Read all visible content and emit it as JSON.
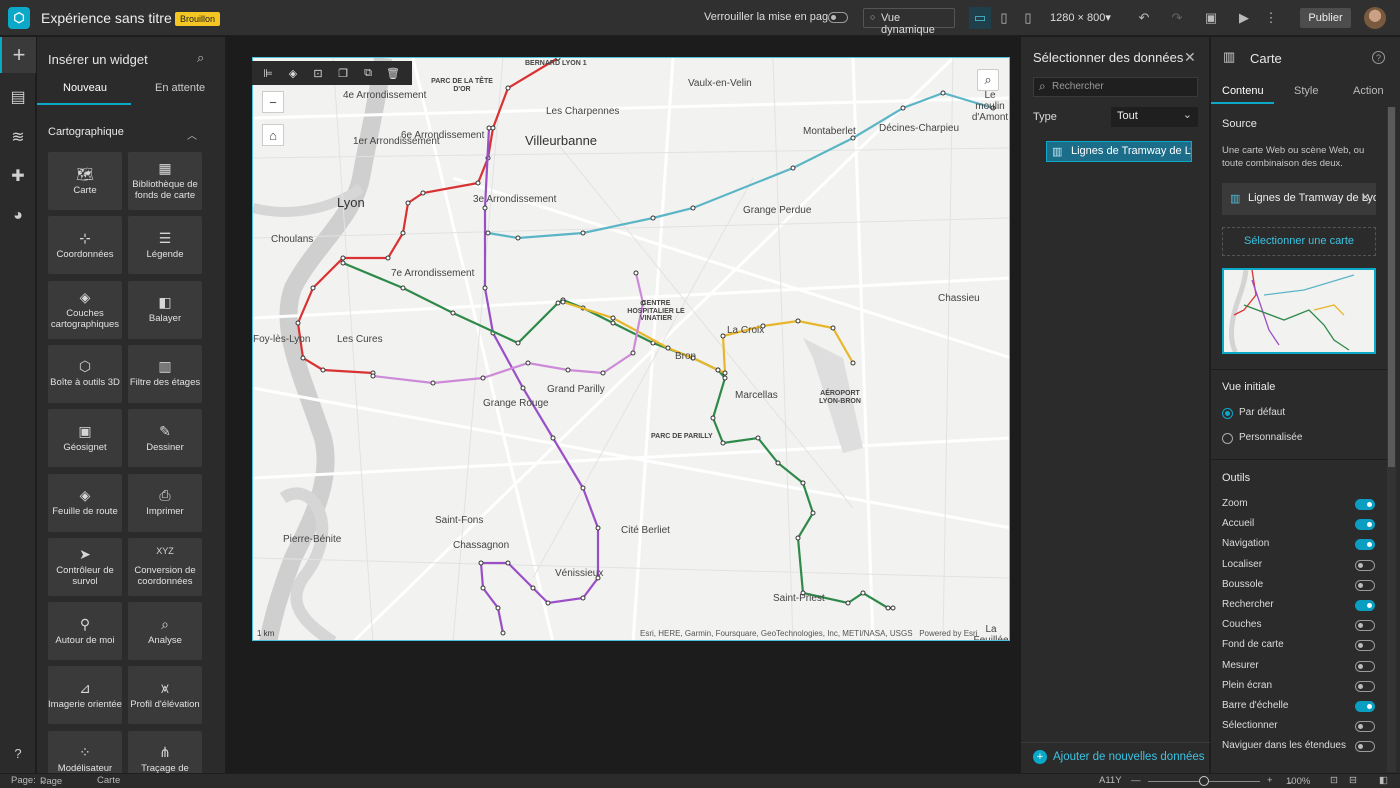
{
  "app": {
    "title": "Expérience sans titre 1",
    "badge": "Brouillon"
  },
  "topbar": {
    "lock_label": "Verrouiller la mise en page",
    "live_view_label": "Vue dynamique",
    "resolution": "1280 × 800",
    "publish_label": "Publier"
  },
  "widget_panel": {
    "title": "Insérer un widget",
    "tabs": [
      "Nouveau",
      "En attente"
    ],
    "category": "Cartographique",
    "widgets": [
      {
        "label": "Carte",
        "icon": "map-icon",
        "glyph": "🗺"
      },
      {
        "label": "Bibliothèque de fonds de carte",
        "icon": "basemap-gallery-icon",
        "glyph": "▦"
      },
      {
        "label": "Coordonnées",
        "icon": "coordinates-icon",
        "glyph": "⊹"
      },
      {
        "label": "Légende",
        "icon": "legend-icon",
        "glyph": "☰"
      },
      {
        "label": "Couches cartographiques",
        "icon": "layers-icon",
        "glyph": "◈"
      },
      {
        "label": "Balayer",
        "icon": "swipe-icon",
        "glyph": "◧"
      },
      {
        "label": "Boîte à outils 3D",
        "icon": "toolbox-3d-icon",
        "glyph": "⬡"
      },
      {
        "label": "Filtre des étages",
        "icon": "floor-filter-icon",
        "glyph": "▥"
      },
      {
        "label": "Géosignet",
        "icon": "bookmark-icon",
        "glyph": "▣"
      },
      {
        "label": "Dessiner",
        "icon": "draw-icon",
        "glyph": "✎"
      },
      {
        "label": "Feuille de route",
        "icon": "directions-icon",
        "glyph": "◈"
      },
      {
        "label": "Imprimer",
        "icon": "print-icon",
        "glyph": "⎙"
      },
      {
        "label": "Contrôleur de survol",
        "icon": "fly-controller-icon",
        "glyph": "➤"
      },
      {
        "label": "Conversion de coordonnées",
        "icon": "coordinate-conversion-icon",
        "glyph": "XYZ"
      },
      {
        "label": "Autour de moi",
        "icon": "near-me-icon",
        "glyph": "⚲"
      },
      {
        "label": "Analyse",
        "icon": "analysis-icon",
        "glyph": "⌕"
      },
      {
        "label": "Imagerie orientée",
        "icon": "oriented-imagery-icon",
        "glyph": "⊿"
      },
      {
        "label": "Profil d'élévation",
        "icon": "elevation-profile-icon",
        "glyph": "⩙"
      },
      {
        "label": "Modélisateur",
        "icon": "modeler-icon",
        "glyph": "⁘"
      },
      {
        "label": "Traçage de",
        "icon": "tracing-icon",
        "glyph": "⋔"
      }
    ]
  },
  "map": {
    "labels": [
      {
        "t": "BERNARD LYON 1",
        "small": true
      },
      {
        "t": "Vaulx-en-Velin"
      },
      {
        "t": "PARC DE LA TÊTE D'OR",
        "small": true
      },
      {
        "t": "Le moulin d'Amont",
        "small": false
      },
      {
        "t": "4e Arrondissement"
      },
      {
        "t": "Les Charpennes"
      },
      {
        "t": "Villeurbanne",
        "big": true
      },
      {
        "t": "Montaberlet"
      },
      {
        "t": "Décines-Charpieu"
      },
      {
        "t": "1er Arrondissement"
      },
      {
        "t": "6e Arrondissement"
      },
      {
        "t": "Lyon",
        "big": true
      },
      {
        "t": "3e Arrondissement"
      },
      {
        "t": "Grange Perdue"
      },
      {
        "t": "Choulans"
      },
      {
        "t": "7e Arrondissement"
      },
      {
        "t": "Chassieu"
      },
      {
        "t": "CENTRE HOSPITALIER LE VINATIER",
        "small": true
      },
      {
        "t": "La Croix"
      },
      {
        "t": "Les Cures"
      },
      {
        "t": "Bron"
      },
      {
        "t": "AÉROPORT LYON-BRON",
        "small": true
      },
      {
        "t": "Grand Parilly"
      },
      {
        "t": "Marcellas"
      },
      {
        "t": "Grange Rouge"
      },
      {
        "t": "PARC DE PARILLY",
        "small": true
      },
      {
        "t": "Saint-Fons"
      },
      {
        "t": "Cité Berliet"
      },
      {
        "t": "Pierre-Bénite"
      },
      {
        "t": "Chassagnon"
      },
      {
        "t": "Vénissieux"
      },
      {
        "t": "Saint-Priest"
      },
      {
        "t": "Foy-lès-Lyon"
      },
      {
        "t": "La Feuillée"
      }
    ],
    "scale_label": "1 km",
    "attribution": "Esri, HERE, Garmin, Foursquare, GeoTechnologies, Inc, METI/NASA, USGS",
    "powered_by": "Powered by Esri"
  },
  "data_panel": {
    "title": "Sélectionner des données",
    "search_placeholder": "Rechercher",
    "type_label": "Type",
    "type_value": "Tout",
    "selected_item": "Lignes de Tramway de Lyon",
    "add_label": "Ajouter de nouvelles données"
  },
  "settings_panel": {
    "title": "Carte",
    "tabs": [
      "Contenu",
      "Style",
      "Action"
    ],
    "source_title": "Source",
    "source_desc": "Une carte Web ou scène Web, ou toute combinaison des deux.",
    "source_item": "Lignes de Tramway de Lyon",
    "select_map_label": "Sélectionner une carte",
    "initial_view_title": "Vue initiale",
    "initial_view_options": [
      "Par défaut",
      "Personnalisée"
    ],
    "tools_title": "Outils",
    "tools": [
      {
        "label": "Zoom",
        "on": true
      },
      {
        "label": "Accueil",
        "on": true
      },
      {
        "label": "Navigation",
        "on": true
      },
      {
        "label": "Localiser",
        "on": false
      },
      {
        "label": "Boussole",
        "on": false
      },
      {
        "label": "Rechercher",
        "on": true
      },
      {
        "label": "Couches",
        "on": false
      },
      {
        "label": "Fond de carte",
        "on": false
      },
      {
        "label": "Mesurer",
        "on": false
      },
      {
        "label": "Plein écran",
        "on": false
      },
      {
        "label": "Barre d'échelle",
        "on": true
      },
      {
        "label": "Sélectionner",
        "on": false
      },
      {
        "label": "Naviguer dans les étendues",
        "on": false
      }
    ]
  },
  "statusbar": {
    "page_label": "Page:",
    "page_value": "Page",
    "breadcrumb": "Carte",
    "a11y": "A11Y",
    "zoom": "100%",
    "zoom_level": 0.5
  },
  "colors": {
    "accent": "#0ba8c8",
    "tram_t1": "#d93232",
    "tram_t2": "#9a4fc7",
    "tram_t3": "#5bb5c6",
    "tram_t4": "#2f8a4a",
    "tram_t5": "#e8b62a",
    "tram_t6": "#cc8ad8"
  }
}
